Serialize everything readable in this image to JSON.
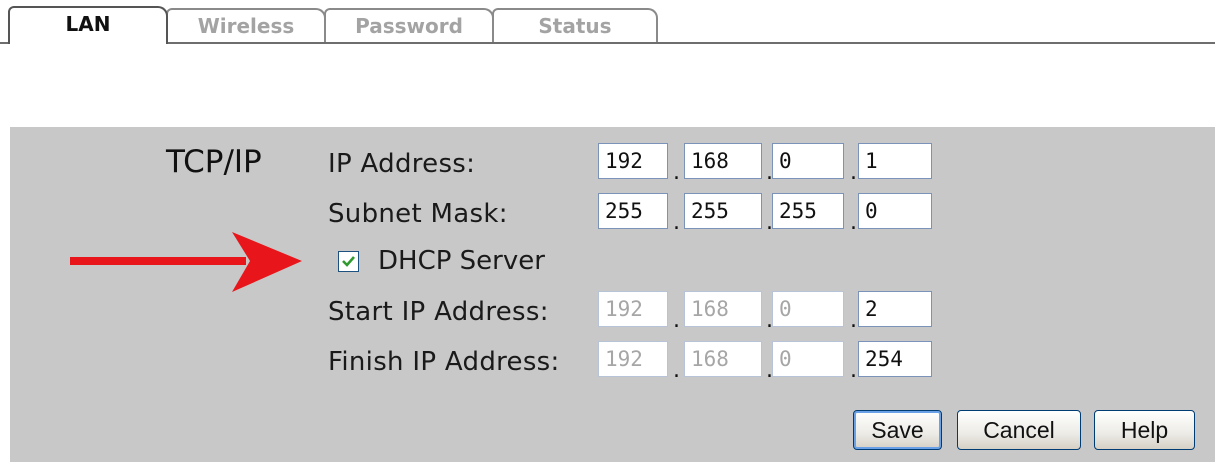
{
  "tabs": [
    {
      "label": "LAN",
      "active": true
    },
    {
      "label": "Wireless",
      "active": false
    },
    {
      "label": "Password",
      "active": false
    },
    {
      "label": "Status",
      "active": false
    }
  ],
  "section": {
    "label": "TCP/IP"
  },
  "fields": {
    "ip_address": {
      "label": "IP Address:",
      "octets": [
        "192",
        "168",
        "0",
        "1"
      ]
    },
    "subnet_mask": {
      "label": "Subnet Mask:",
      "octets": [
        "255",
        "255",
        "255",
        "0"
      ]
    },
    "start_ip": {
      "label": "Start IP Address:",
      "octets": [
        "192",
        "168",
        "0",
        "2"
      ]
    },
    "finish_ip": {
      "label": "Finish IP Address:",
      "octets": [
        "192",
        "168",
        "0",
        "254"
      ]
    }
  },
  "dhcp": {
    "label": "DHCP Server",
    "checked": true
  },
  "buttons": {
    "save": "Save",
    "cancel": "Cancel",
    "help": "Help"
  },
  "colors": {
    "panel": "#c8c8c8",
    "arrow": "#e8161b",
    "checkmark": "#2f9b2f",
    "disabled_text": "#a6a6a6"
  },
  "icons": {
    "arrow": "red-right-arrow-icon",
    "check": "checkmark-icon"
  }
}
